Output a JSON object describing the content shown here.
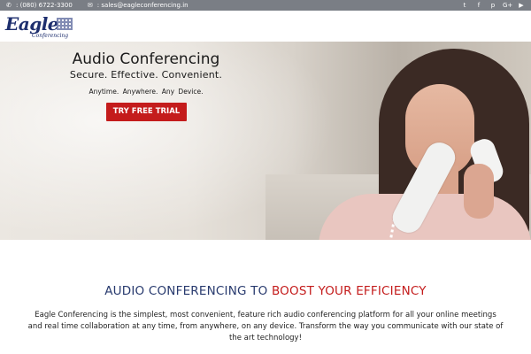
{
  "topbar": {
    "phone": ": (080) 6722-3300",
    "email": ": sales@eagleconferencing.in",
    "phone_icon": "phone-icon",
    "email_icon": "envelope-icon",
    "social": [
      {
        "icon": "twitter-icon",
        "glyph": "t"
      },
      {
        "icon": "facebook-icon",
        "glyph": "f"
      },
      {
        "icon": "pinterest-icon",
        "glyph": "p"
      },
      {
        "icon": "google-plus-icon",
        "glyph": "G+"
      },
      {
        "icon": "youtube-icon",
        "glyph": "▶"
      }
    ]
  },
  "logo": {
    "name": "Eagle",
    "subtitle": "Conferencing"
  },
  "hero": {
    "title": "Audio Conferencing",
    "subtitle": "Secure. Effective. Convenient.",
    "tagline": "Anytime.  Anywhere.  Any Device.",
    "cta_label": "TRY FREE TRIAL"
  },
  "section": {
    "headline_part1": "AUDIO CONFERENCING TO ",
    "headline_part2": "BOOST YOUR EFFICIENCY",
    "body": "Eagle Conferencing is the simplest, most convenient, feature rich audio conferencing platform for all your online meetings and real time collaboration at any time, from anywhere, on any device. Transform the way you communicate with our state of the art technology!"
  },
  "colors": {
    "accent_red": "#c41c1c",
    "navy": "#283a6e",
    "topbar_bg": "#7a7e85"
  }
}
